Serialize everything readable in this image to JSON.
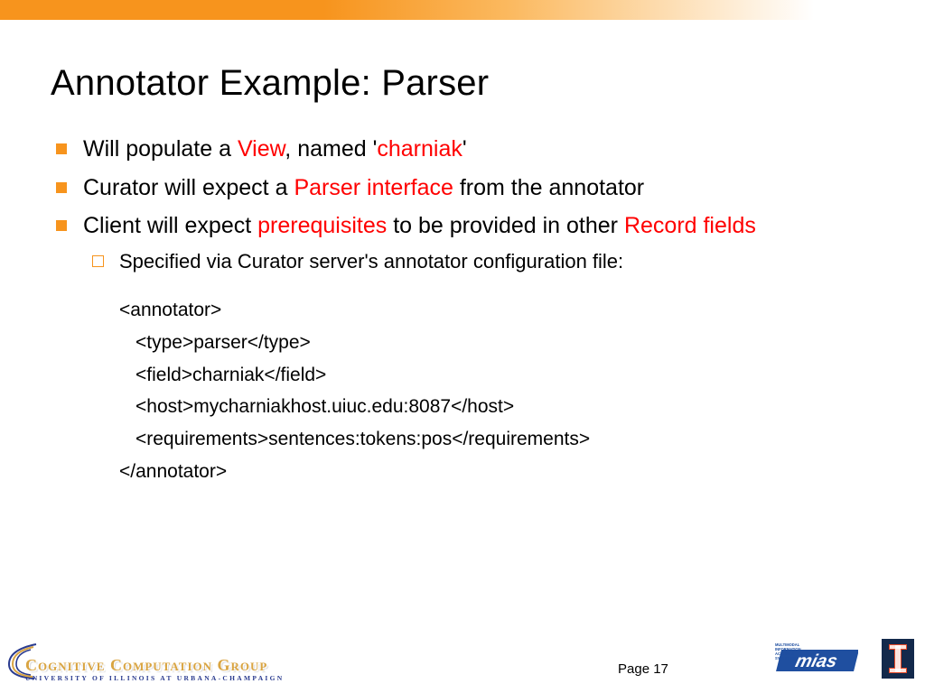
{
  "title": "Annotator Example: Parser",
  "bullets": {
    "b1": {
      "pre": "Will populate a ",
      "hl1": "View",
      "mid": ", named '",
      "hl2": "charniak",
      "post": "'"
    },
    "b2": {
      "pre": "Curator will expect a ",
      "hl1": "Parser interface",
      "post": " from the annotator"
    },
    "b3": {
      "pre": "Client will expect ",
      "hl1": "prerequisites",
      "mid": " to be provided in other ",
      "hl2": "Record fields"
    },
    "sub1": "Specified via Curator server's annotator configuration file:"
  },
  "code": {
    "l1": "<annotator>",
    "l2": "<type>parser</type>",
    "l3": "<field>charniak</field>",
    "l4": "<host>mycharniakhost.uiuc.edu:8087</host>",
    "l5": "<requirements>sentences:tokens:pos</requirements>",
    "l6": "</annotator>"
  },
  "footer": {
    "page": "Page 17",
    "ccg_main": "Cognitive Computation Group",
    "ccg_sub": "University of Illinois at Urbana-Champaign",
    "mias_text": "mias",
    "mias_side": "MULTIMODAL INFORMATION ACCESS & SYNTHESIS"
  }
}
